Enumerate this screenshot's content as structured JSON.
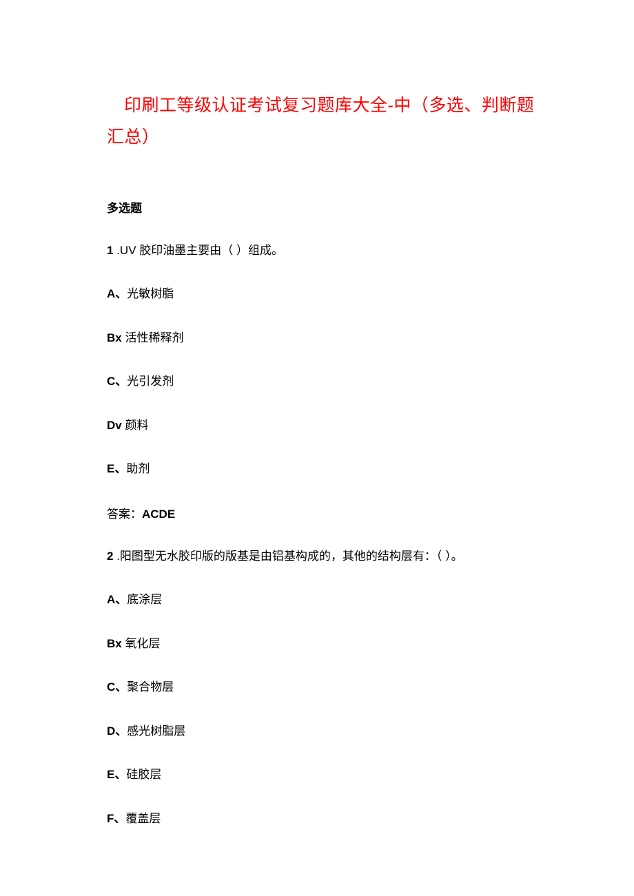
{
  "title": "印刷工等级认证考试复习题库大全-中（多选、判断题汇总）",
  "section_heading": "多选题",
  "questions": [
    {
      "number": "1",
      "text": ".UV 胶印油墨主要由（ ）组成。",
      "options": [
        {
          "label": "A、",
          "text": "光敏树脂"
        },
        {
          "label": "Bx ",
          "text": "活性稀释剂"
        },
        {
          "label": "C、",
          "text": "光引发剂"
        },
        {
          "label": "Dv ",
          "text": "颜料"
        },
        {
          "label": "E、",
          "text": "助剂"
        }
      ],
      "answer_label": "答案：",
      "answer_value": "ACDE"
    },
    {
      "number": "2",
      "text": ".阳图型无水胶印版的版基是由铝基构成的，其他的结构层有：（ ）。",
      "options": [
        {
          "label": "A、",
          "text": "底涂层"
        },
        {
          "label": "Bx ",
          "text": "氧化层"
        },
        {
          "label": "C、",
          "text": "聚合物层"
        },
        {
          "label": "D、",
          "text": "感光树脂层"
        },
        {
          "label": "E、",
          "text": "硅胶层"
        },
        {
          "label": "F、",
          "text": "覆盖层"
        }
      ]
    }
  ]
}
